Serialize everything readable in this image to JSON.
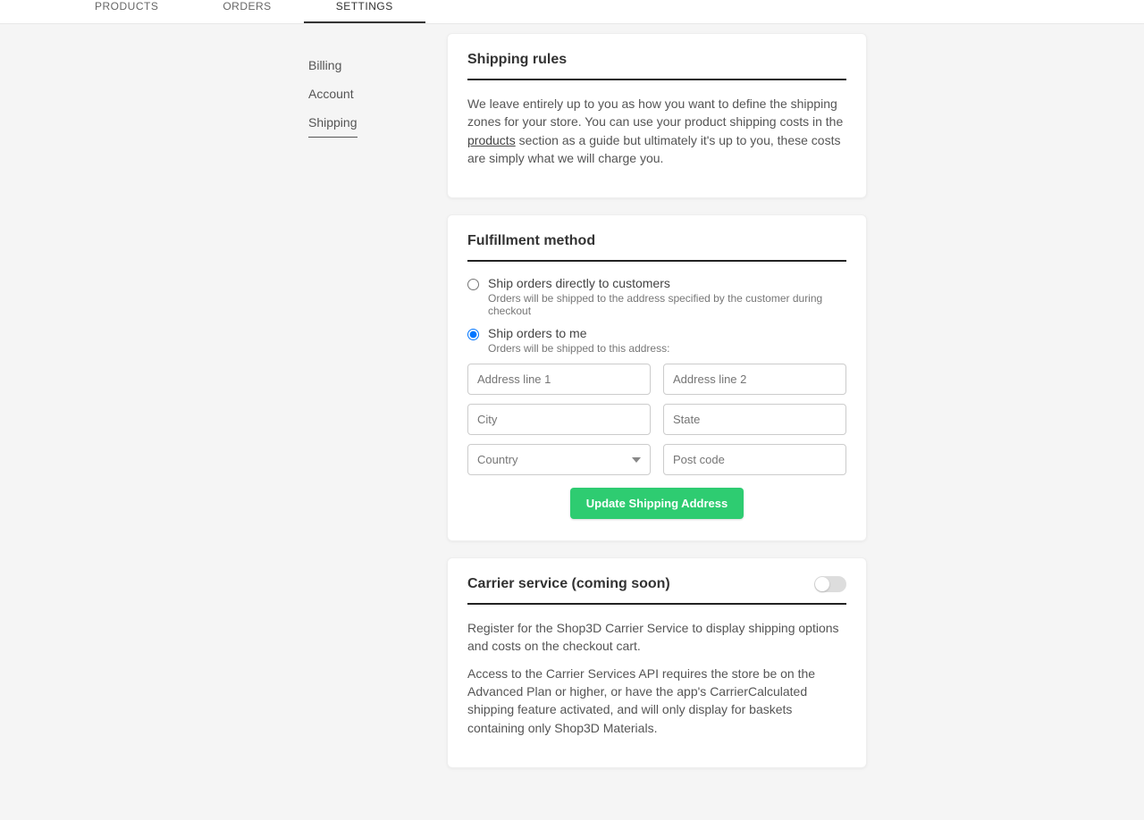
{
  "topnav": {
    "items": [
      "PRODUCTS",
      "ORDERS",
      "SETTINGS"
    ],
    "active": 2
  },
  "sidebar": {
    "items": [
      "Billing",
      "Account",
      "Shipping"
    ],
    "active": 2
  },
  "shipping_rules": {
    "title": "Shipping rules",
    "text_before": "We leave entirely up to you as how you want to define the shipping zones for your store. You can use your product shipping costs in the ",
    "link": "products",
    "text_after": " section as a guide but ultimately it's up to you, these costs are simply what we will charge you."
  },
  "fulfillment": {
    "title": "Fulfillment method",
    "opt1_label": "Ship orders directly to customers",
    "opt1_sub": "Orders will be shipped to the address specified by the customer during checkout",
    "opt2_label": "Ship orders to me",
    "opt2_sub": "Orders will be shipped to this address:",
    "address": {
      "line1_placeholder": "Address line 1",
      "line2_placeholder": "Address line 2",
      "city_placeholder": "City",
      "state_placeholder": "State",
      "country_placeholder": "Country",
      "post_placeholder": "Post code"
    },
    "button": "Update Shipping Address"
  },
  "carrier": {
    "title": "Carrier service (coming soon)",
    "p1": "Register for the Shop3D Carrier Service to display shipping options and costs on the checkout cart.",
    "p2": "Access to the Carrier Services API requires the store be on the Advanced Plan or higher, or have the app's CarrierCalculated shipping feature activated, and will only display for baskets containing only Shop3D Materials."
  }
}
